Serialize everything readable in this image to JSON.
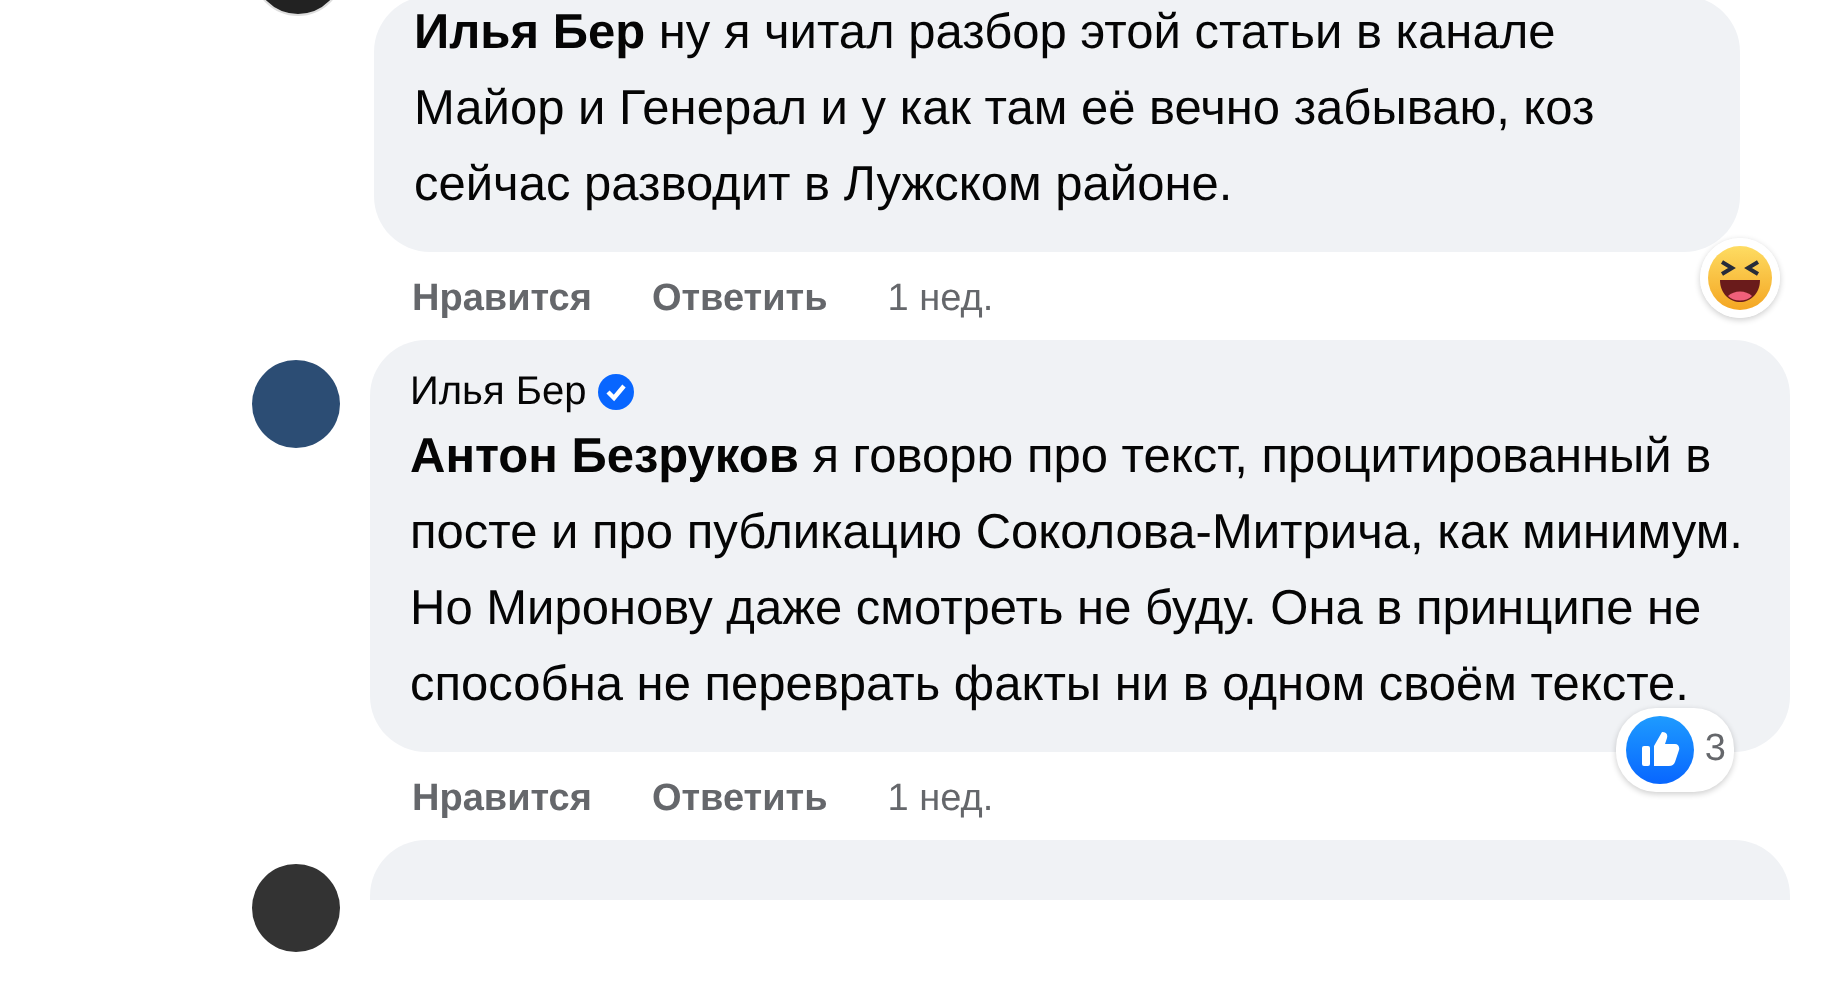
{
  "comments": [
    {
      "text": "**Илья Бер** ну я читал разбор этой статьи в канале Майор и Генерал и у как там её вечно забываю, коз сейчас разводит в Лужском районе.",
      "reactions": [
        {
          "kind": "haha"
        }
      ],
      "actions": [
        "Нравится",
        "Ответить"
      ],
      "time": "1 нед."
    },
    {
      "author": "Илья Бер",
      "verified": true,
      "text": "**Антон Безруков** я говорю про текст, процитированный в посте и про публикацию Соколова-Митрича, как минимум. Но Миронову даже смотреть не буду. Она в принципе не способна не переврать факты ни в одном своём тексте.",
      "reactions": [
        {
          "kind": "like"
        }
      ],
      "reaction_count": "3",
      "actions": [
        "Нравится",
        "Ответить"
      ],
      "time": "1 нед."
    }
  ]
}
